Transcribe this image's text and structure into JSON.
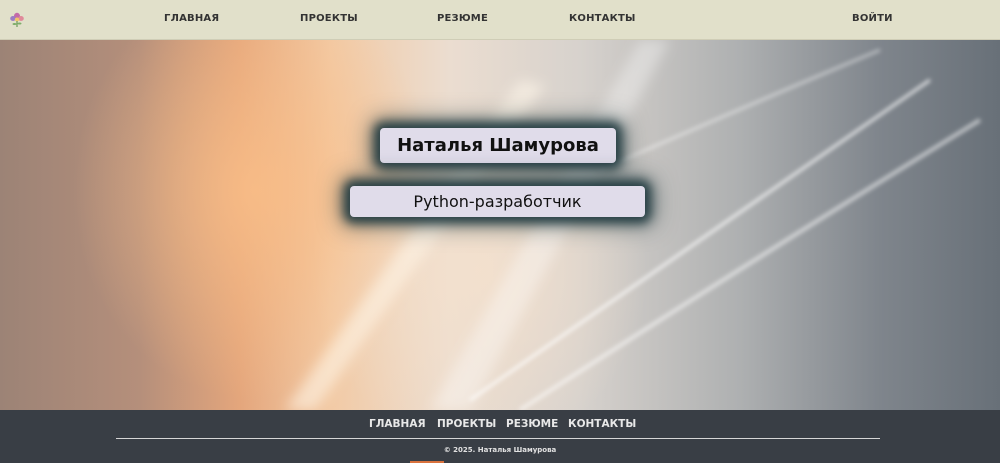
{
  "topnav": {
    "logo_icon": "flower-icon",
    "items": [
      {
        "label": "ГЛАВНАЯ"
      },
      {
        "label": "ПРОЕКТЫ"
      },
      {
        "label": "РЕЗЮМЕ"
      },
      {
        "label": "КОНТАКТЫ"
      }
    ],
    "login_label": "ВОЙТИ"
  },
  "hero": {
    "name": "Наталья Шамурова",
    "role": "Python-разработчик"
  },
  "footer": {
    "items": [
      {
        "label": "ГЛАВНАЯ"
      },
      {
        "label": "ПРОЕКТЫ"
      },
      {
        "label": "РЕЗЮМЕ"
      },
      {
        "label": "КОНТАКТЫ"
      }
    ],
    "copyright": "© 2025. Наталья Шамурова"
  },
  "colors": {
    "nav_bg": "#e1e0ca",
    "footer_bg": "#393e45",
    "card_bg": "#e0dcea",
    "accent": "#d9723d"
  }
}
